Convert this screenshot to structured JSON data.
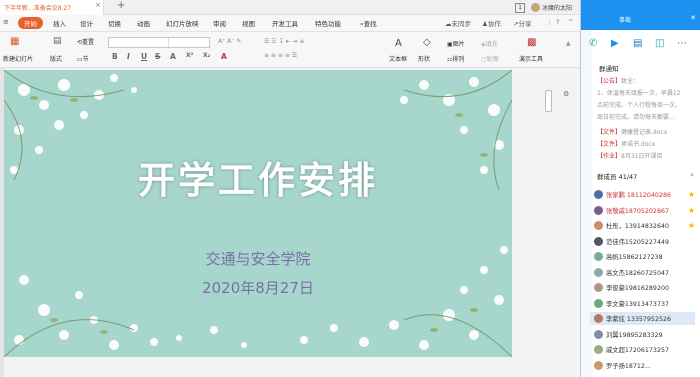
{
  "wps": {
    "tab_title": "下半年新...准备会议8.27",
    "tab_close": "×",
    "tab_add": "+",
    "window_badge": "1",
    "user_name": "冰魔的太阳",
    "menu": [
      "开始",
      "插入",
      "设计",
      "切换",
      "动画",
      "幻灯片放映",
      "审阅",
      "视图",
      "开发工具",
      "特色功能"
    ],
    "search_label": "查找",
    "right_actions": [
      "未同步",
      "协作",
      "分享"
    ],
    "toolbar": {
      "new_slide": "新建幻灯片",
      "layout": "版式",
      "section": "节",
      "reset": "重置",
      "textbox": "文本框",
      "shape": "形状",
      "arrange": "排列",
      "picture": "图片",
      "fill": "填充",
      "outline": "轮廓",
      "present": "演示工具"
    },
    "format_buttons": [
      "B",
      "I",
      "U",
      "S",
      "A",
      "X²",
      "X₂",
      "A"
    ]
  },
  "slide": {
    "title": "开学工作安排",
    "subtitle": "交通与安全学院",
    "date": "2020年8月27日"
  },
  "qq": {
    "title": "事截",
    "notice_title": "群通知",
    "notice_header": "【公告】",
    "notice_header_gray": "致全：",
    "notice_lines": [
      "1、体温每天填报一次，早晨12",
      "点前完成。个人行程每周一次，",
      "周日前完成。请勿每天都要..."
    ],
    "files": [
      {
        "tag": "【文件】",
        "name": "健康登记表.docx"
      },
      {
        "tag": "【文件】",
        "name": "承诺书.docx"
      },
      {
        "tag": "【作业】",
        "name": "8月31日开课目"
      }
    ],
    "members_title": "群成员 41/47",
    "members": [
      {
        "name": "张家鹏 18112040286",
        "color": "#c33",
        "star": true,
        "av": "#4a6fa5"
      },
      {
        "name": "张敬威18705202867",
        "color": "#c33",
        "star": true,
        "av": "#7a5c8f"
      },
      {
        "name": "杜彤，13914832640",
        "color": "#333",
        "star": true,
        "av": "#d08a6a"
      },
      {
        "name": "范佳伟15205227449",
        "color": "#333",
        "star": false,
        "av": "#556"
      },
      {
        "name": "高帆15862127238",
        "color": "#333",
        "star": false,
        "av": "#7a9"
      },
      {
        "name": "高文杰18260725047",
        "color": "#333",
        "star": false,
        "av": "#8aa"
      },
      {
        "name": "李俊豪19816289200",
        "color": "#333",
        "star": false,
        "av": "#a98"
      },
      {
        "name": "李文豪13913473737",
        "color": "#333",
        "star": false,
        "av": "#6a7"
      },
      {
        "name": "李紫炫 13357952526",
        "color": "#333",
        "star": false,
        "av": "#b76",
        "selected": true
      },
      {
        "name": "刘翼19895283329",
        "color": "#333",
        "star": false,
        "av": "#88a"
      },
      {
        "name": "戚文超17206173257",
        "color": "#333",
        "star": false,
        "av": "#9a8"
      },
      {
        "name": "罗子扬18712...",
        "color": "#333",
        "star": false,
        "av": "#c96"
      }
    ]
  }
}
